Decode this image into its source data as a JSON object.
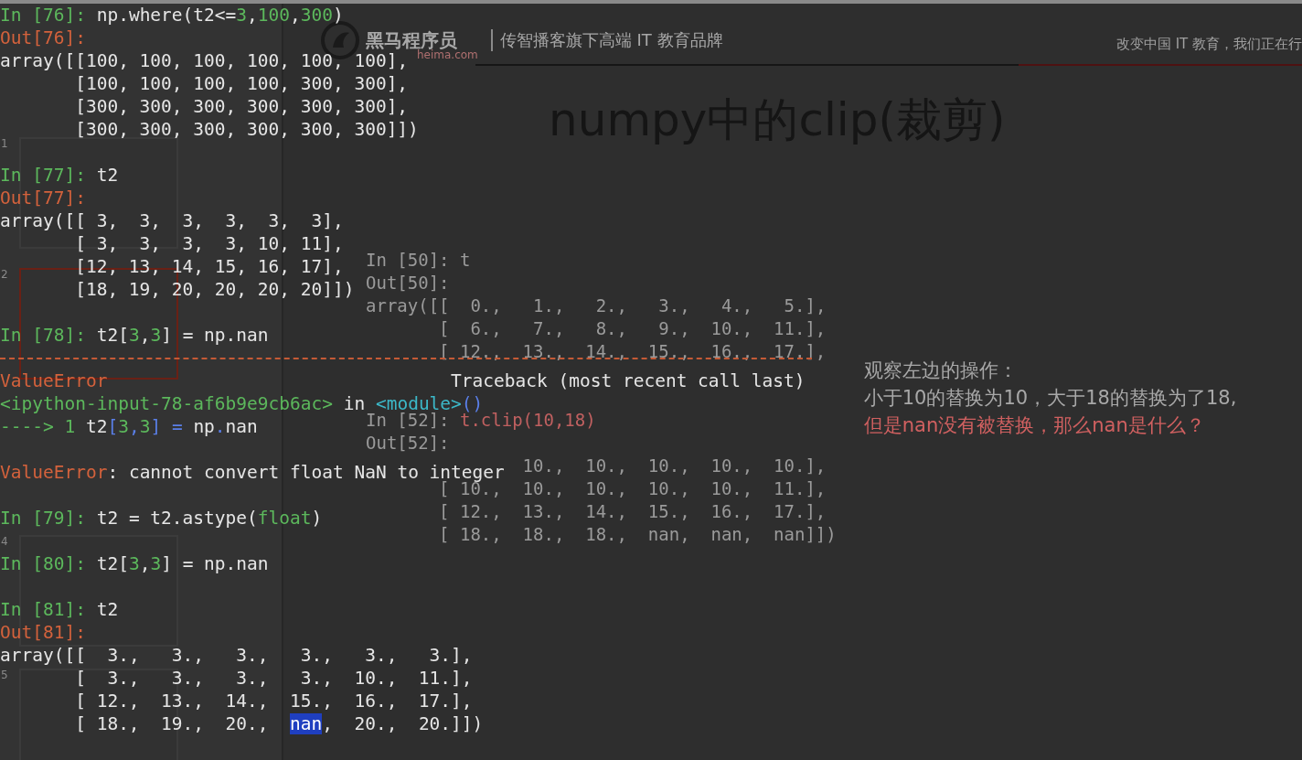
{
  "slide": {
    "brand": {
      "name": "黑马程序员",
      "site": "heima.com",
      "tagline": "传智播客旗下高端 IT 教育品牌",
      "slogan": "改变中国 IT 教育，我们正在行"
    },
    "title": "numpy中的clip(裁剪)",
    "code": [
      {
        "kind": "code",
        "segments": [
          {
            "kind": "plain",
            "text": "In [50]: t"
          }
        ]
      },
      {
        "kind": "code",
        "segments": [
          {
            "kind": "plain",
            "text": "Out[50]:"
          }
        ]
      },
      {
        "kind": "code",
        "segments": [
          {
            "kind": "plain",
            "text": "array([[  0.,   1.,   2.,   3.,   4.,   5.],"
          }
        ]
      },
      {
        "kind": "cont",
        "segments": [
          {
            "kind": "plain",
            "text": "[  6.,   7.,   8.,   9.,  10.,  11.],"
          }
        ]
      },
      {
        "kind": "cont",
        "segments": [
          {
            "kind": "plain",
            "text": "[ 12.,  13.,  14.,  15.,  16.,  17.],"
          }
        ]
      },
      {
        "kind": "blank"
      },
      {
        "kind": "blank"
      },
      {
        "kind": "code",
        "segments": [
          {
            "kind": "plain",
            "text": "In [52]: "
          },
          {
            "kind": "cmd",
            "text": "t.clip(10,18)"
          }
        ]
      },
      {
        "kind": "code",
        "segments": [
          {
            "kind": "plain",
            "text": "Out[52]:"
          }
        ]
      },
      {
        "kind": "partial",
        "segments": [
          {
            "kind": "plain",
            "text": "10.,  10.,  10.,  10.,  10.],"
          }
        ]
      },
      {
        "kind": "cont",
        "segments": [
          {
            "kind": "plain",
            "text": "[ 10.,  10.,  10.,  10.,  10.,  11.],"
          }
        ]
      },
      {
        "kind": "cont",
        "segments": [
          {
            "kind": "plain",
            "text": "[ 12.,  13.,  14.,  15.,  16.,  17.],"
          }
        ]
      },
      {
        "kind": "cont",
        "segments": [
          {
            "kind": "plain",
            "text": "[ 18.,  18.,  18.,  nan,  nan,  nan]])"
          }
        ]
      }
    ],
    "notes": [
      {
        "kind": "normal",
        "text": "观察左边的操作："
      },
      {
        "kind": "normal",
        "text": "小于10的替换为10，大于18的替换为了18,"
      },
      {
        "kind": "emphasis",
        "text": "但是nan没有被替换，那么nan是什么？"
      }
    ],
    "thumbnails": [
      {
        "number": "1",
        "selected": false
      },
      {
        "number": "2",
        "selected": true
      },
      {
        "number": "4",
        "selected": false
      },
      {
        "number": "5",
        "selected": false
      }
    ]
  },
  "terminal": {
    "lines": [
      {
        "kind": "code",
        "segments": [
          {
            "kind": "prompt",
            "text": "In [76]: "
          },
          {
            "kind": "plain",
            "text": "np.where(t2<="
          },
          {
            "kind": "num",
            "text": "3"
          },
          {
            "kind": "plain",
            "text": ","
          },
          {
            "kind": "num",
            "text": "100"
          },
          {
            "kind": "plain",
            "text": ","
          },
          {
            "kind": "num",
            "text": "300"
          },
          {
            "kind": "plain",
            "text": ")"
          }
        ]
      },
      {
        "kind": "code",
        "segments": [
          {
            "kind": "out",
            "text": "Out[76]:"
          }
        ]
      },
      {
        "kind": "code",
        "segments": [
          {
            "kind": "plain",
            "text": "array([[100, 100, 100, 100, 100, 100],"
          }
        ]
      },
      {
        "kind": "cont",
        "segments": [
          {
            "kind": "plain",
            "text": "[100, 100, 100, 100, 300, 300],"
          }
        ]
      },
      {
        "kind": "cont",
        "segments": [
          {
            "kind": "plain",
            "text": "[300, 300, 300, 300, 300, 300],"
          }
        ]
      },
      {
        "kind": "cont",
        "segments": [
          {
            "kind": "plain",
            "text": "[300, 300, 300, 300, 300, 300]])"
          }
        ]
      },
      {
        "kind": "blank"
      },
      {
        "kind": "code",
        "segments": [
          {
            "kind": "prompt",
            "text": "In [77]: "
          },
          {
            "kind": "plain",
            "text": "t2"
          }
        ]
      },
      {
        "kind": "code",
        "segments": [
          {
            "kind": "out",
            "text": "Out[77]:"
          }
        ]
      },
      {
        "kind": "code",
        "segments": [
          {
            "kind": "plain",
            "text": "array([[ 3,  3,  3,  3,  3,  3],"
          }
        ]
      },
      {
        "kind": "cont",
        "segments": [
          {
            "kind": "plain",
            "text": "[ 3,  3,  3,  3, 10, 11],"
          }
        ]
      },
      {
        "kind": "cont",
        "segments": [
          {
            "kind": "plain",
            "text": "[12, 13, 14, 15, 16, 17],"
          }
        ]
      },
      {
        "kind": "cont",
        "segments": [
          {
            "kind": "plain",
            "text": "[18, 19, 20, 20, 20, 20]])"
          }
        ]
      },
      {
        "kind": "blank"
      },
      {
        "kind": "code",
        "segments": [
          {
            "kind": "prompt",
            "text": "In [78]: "
          },
          {
            "kind": "plain",
            "text": "t2["
          },
          {
            "kind": "num",
            "text": "3"
          },
          {
            "kind": "plain",
            "text": ","
          },
          {
            "kind": "num",
            "text": "3"
          },
          {
            "kind": "plain",
            "text": "] = np.nan"
          }
        ]
      },
      {
        "kind": "rule"
      },
      {
        "kind": "code",
        "segments": [
          {
            "kind": "error",
            "text": "ValueError"
          },
          {
            "kind": "plain",
            "text": "                                Traceback (most recent call last)"
          }
        ]
      },
      {
        "kind": "code",
        "segments": [
          {
            "kind": "num",
            "text": "<ipython-input-78-af6b9e9cb6ac>"
          },
          {
            "kind": "plain",
            "text": " in "
          },
          {
            "kind": "module",
            "text": "<module>"
          },
          {
            "kind": "punct",
            "text": "()"
          }
        ]
      },
      {
        "kind": "code",
        "segments": [
          {
            "kind": "num",
            "text": "----> 1 "
          },
          {
            "kind": "plain",
            "text": "t2"
          },
          {
            "kind": "punct",
            "text": "["
          },
          {
            "kind": "num",
            "text": "3"
          },
          {
            "kind": "punct",
            "text": ","
          },
          {
            "kind": "num",
            "text": "3"
          },
          {
            "kind": "punct",
            "text": "] = "
          },
          {
            "kind": "plain",
            "text": "np"
          },
          {
            "kind": "punct",
            "text": "."
          },
          {
            "kind": "plain",
            "text": "nan"
          }
        ]
      },
      {
        "kind": "blank"
      },
      {
        "kind": "code",
        "segments": [
          {
            "kind": "error",
            "text": "ValueError"
          },
          {
            "kind": "plain",
            "text": ": cannot convert float NaN to integer"
          }
        ]
      },
      {
        "kind": "blank"
      },
      {
        "kind": "code",
        "segments": [
          {
            "kind": "prompt",
            "text": "In [79]: "
          },
          {
            "kind": "plain",
            "text": "t2 = t2.astype("
          },
          {
            "kind": "num",
            "text": "float"
          },
          {
            "kind": "plain",
            "text": ")"
          }
        ]
      },
      {
        "kind": "blank"
      },
      {
        "kind": "code",
        "segments": [
          {
            "kind": "prompt",
            "text": "In [80]: "
          },
          {
            "kind": "plain",
            "text": "t2["
          },
          {
            "kind": "num",
            "text": "3"
          },
          {
            "kind": "plain",
            "text": ","
          },
          {
            "kind": "num",
            "text": "3"
          },
          {
            "kind": "plain",
            "text": "] = np.nan"
          }
        ]
      },
      {
        "kind": "blank"
      },
      {
        "kind": "code",
        "segments": [
          {
            "kind": "prompt",
            "text": "In [81]: "
          },
          {
            "kind": "plain",
            "text": "t2"
          }
        ]
      },
      {
        "kind": "code",
        "segments": [
          {
            "kind": "out",
            "text": "Out[81]:"
          }
        ]
      },
      {
        "kind": "code",
        "segments": [
          {
            "kind": "plain",
            "text": "array([[  3.,   3.,   3.,   3.,   3.,   3.],"
          }
        ]
      },
      {
        "kind": "cont",
        "segments": [
          {
            "kind": "plain",
            "text": "[  3.,   3.,   3.,   3.,  10.,  11.],"
          }
        ]
      },
      {
        "kind": "cont",
        "segments": [
          {
            "kind": "plain",
            "text": "[ 12.,  13.,  14.,  15.,  16.,  17.],"
          }
        ]
      },
      {
        "kind": "cont",
        "segments": [
          {
            "kind": "plain",
            "text": "[ 18.,  19.,  20.,  "
          },
          {
            "kind": "selection",
            "text": "nan"
          },
          {
            "kind": "plain",
            "text": ",  20.,  20.]])"
          }
        ]
      }
    ]
  }
}
